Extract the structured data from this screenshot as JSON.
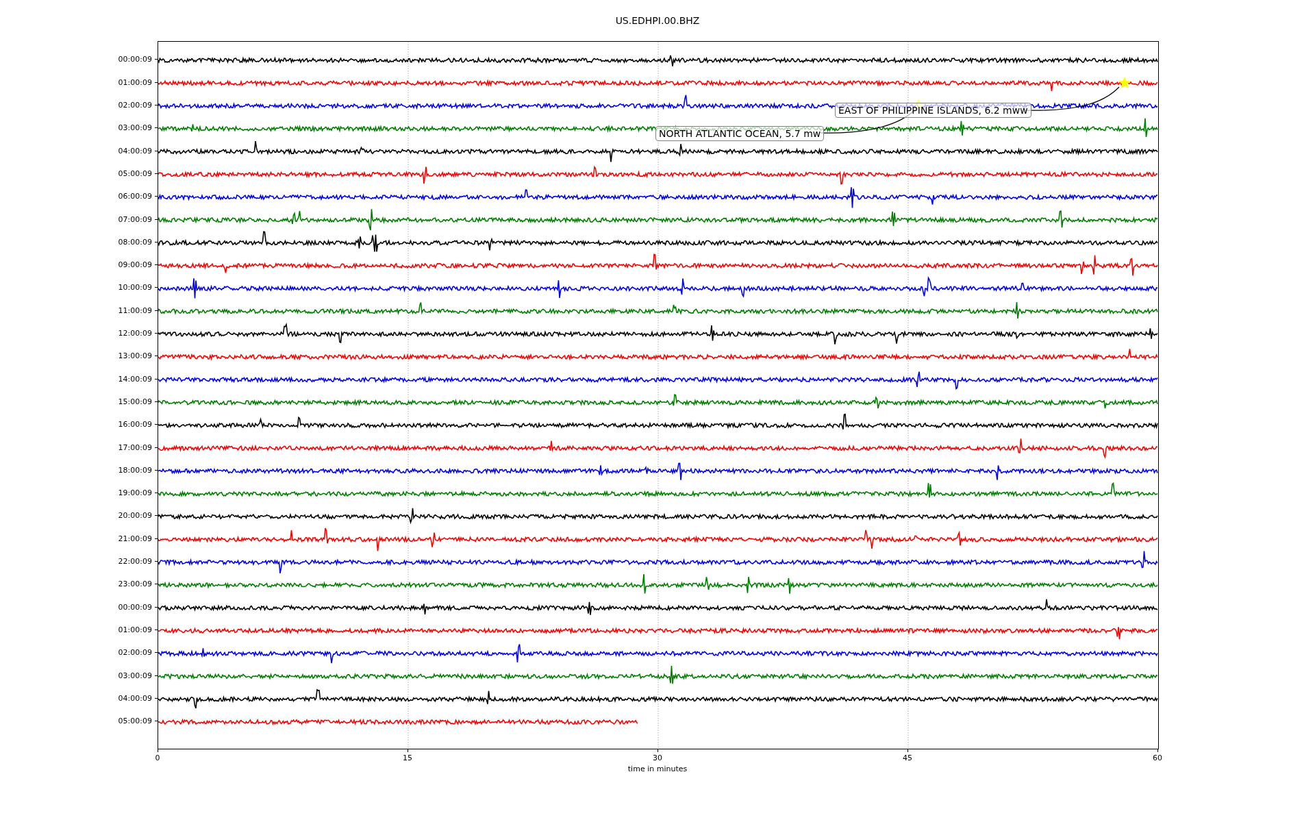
{
  "title": "US.EDHPI.00.BHZ",
  "rows": [
    {
      "label": "00:00:09",
      "color": "#000000",
      "level": 1
    },
    {
      "label": "01:00:09",
      "color": "#ff0000",
      "level": 1
    },
    {
      "label": "02:00:09",
      "color": "#0000ff",
      "level": 1
    },
    {
      "label": "03:00:09",
      "color": "#008000",
      "level": 1
    },
    {
      "label": "04:00:09",
      "color": "#000000",
      "level": 1
    },
    {
      "label": "05:00:09",
      "color": "#ff0000",
      "level": 1
    },
    {
      "label": "06:00:09",
      "color": "#0000ff",
      "level": 1
    },
    {
      "label": "07:00:09",
      "color": "#008000",
      "level": 1
    },
    {
      "label": "08:00:09",
      "color": "#000000",
      "level": 1
    },
    {
      "label": "09:00:09",
      "color": "#ff0000",
      "level": 1
    },
    {
      "label": "10:00:09",
      "color": "#0000ff",
      "level": 1
    },
    {
      "label": "11:00:09",
      "color": "#008000",
      "level": 1
    },
    {
      "label": "12:00:09",
      "color": "#000000",
      "level": 1
    },
    {
      "label": "13:00:09",
      "color": "#ff0000",
      "level": 1
    },
    {
      "label": "14:00:09",
      "color": "#0000ff",
      "level": 1
    },
    {
      "label": "15:00:09",
      "color": "#008000",
      "level": 1
    },
    {
      "label": "16:00:09",
      "color": "#000000",
      "level": 1
    },
    {
      "label": "17:00:09",
      "color": "#ff0000",
      "level": 1
    },
    {
      "label": "18:00:09",
      "color": "#0000ff",
      "level": 1
    },
    {
      "label": "19:00:09",
      "color": "#008000",
      "level": 1
    },
    {
      "label": "20:00:09",
      "color": "#000000",
      "level": 1
    },
    {
      "label": "21:00:09",
      "color": "#ff0000",
      "level": 1
    },
    {
      "label": "22:00:09",
      "color": "#0000ff",
      "level": 1
    },
    {
      "label": "23:00:09",
      "color": "#008000",
      "level": 1
    },
    {
      "label": "00:00:09",
      "color": "#000000",
      "level": 1
    },
    {
      "label": "01:00:09",
      "color": "#ff0000",
      "level": 1
    },
    {
      "label": "02:00:09",
      "color": "#0000ff",
      "level": 1
    },
    {
      "label": "03:00:09",
      "color": "#008000",
      "level": 1
    },
    {
      "label": "04:00:09",
      "color": "#000000",
      "level": 1
    },
    {
      "label": "05:00:09",
      "color": "#ff0000",
      "level": 0.48
    }
  ],
  "xticks": [
    "0",
    "15",
    "30",
    "45",
    "60"
  ],
  "xlabel": "time in minutes",
  "annotations": [
    {
      "text": "EAST OF PHILIPPINE ISLANDS, 6.2 mww"
    },
    {
      "text": "NORTH ATLANTIC OCEAN, 5.7 mw"
    }
  ]
}
